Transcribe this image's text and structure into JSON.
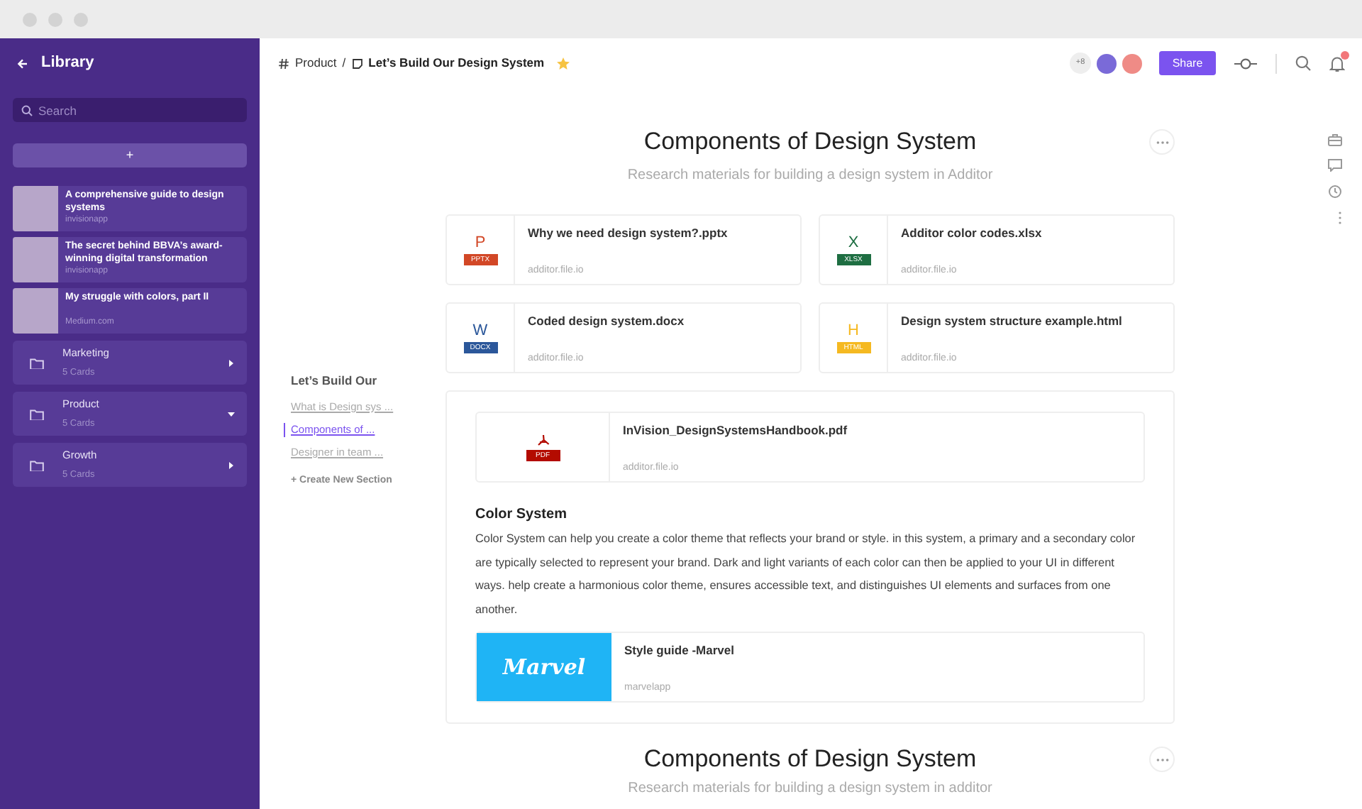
{
  "sidebar": {
    "title": "Library",
    "search": {
      "placeholder": "Search"
    },
    "add_button": "+",
    "articles": [
      {
        "title": "A comprehensive guide to design systems",
        "source": "invisionapp"
      },
      {
        "title": "The secret behind BBVA’s award-winning digital transformation",
        "source": "invisionapp"
      },
      {
        "title": "My struggle with colors, part II",
        "source": "Medium.com"
      }
    ],
    "folders": [
      {
        "name": "Marketing",
        "count": "5 Cards",
        "expanded": false
      },
      {
        "name": "Product",
        "count": "5 Cards",
        "expanded": true
      },
      {
        "name": "Growth",
        "count": "5 Cards",
        "expanded": false
      }
    ]
  },
  "breadcrumb": {
    "workspace": "Product",
    "separator": "/",
    "page": "Let’s Build Our Design System",
    "starred": true
  },
  "toolbar": {
    "extra_members": "+8",
    "share": "Share",
    "unread": true
  },
  "toc": {
    "title": "Let’s Build Our",
    "items": [
      {
        "label": "What is Design sys ...",
        "selected": false
      },
      {
        "label": "Components of ...",
        "selected": true
      },
      {
        "label": "Designer in team ...",
        "selected": false
      }
    ],
    "create": "+ Create New Section"
  },
  "sections": [
    {
      "title": "Components of Design System",
      "subtitle": "Research materials for building a design system in Additor",
      "files": [
        {
          "kind": "pptx",
          "letter": "P",
          "badge": "PPTX",
          "name": "Why we need design system?.pptx",
          "domain": "additor.file.io"
        },
        {
          "kind": "xlsx",
          "letter": "X",
          "badge": "XLSX",
          "name": "Additor color codes.xlsx",
          "domain": "additor.file.io"
        },
        {
          "kind": "docx",
          "letter": "W",
          "badge": "DOCX",
          "name": "Coded design system.docx",
          "domain": "additor.file.io"
        },
        {
          "kind": "html",
          "letter": "H",
          "badge": "HTML",
          "name": "Design system structure example.html",
          "domain": "additor.file.io"
        }
      ],
      "panel": {
        "file": {
          "kind": "pdf",
          "badge": "PDF",
          "name": "InVision_DesignSystemsHandbook.pdf",
          "domain": "additor.file.io"
        },
        "heading": "Color System",
        "text": "Color System can help you create a color theme that reflects your brand or style. in this system, a primary and a secondary color are typically selected to represent your brand. Dark and light variants of each color can then be applied to your UI in different ways. help create a harmonious color theme, ensures accessible text, and distinguishes UI elements and surfaces from one another.",
        "link": {
          "logo_text": "Marvel",
          "title": "Style guide -Marvel",
          "source": "marvelapp"
        }
      }
    },
    {
      "title": "Components of Design System",
      "subtitle": "Research materials for building a design system in additor"
    }
  ]
}
